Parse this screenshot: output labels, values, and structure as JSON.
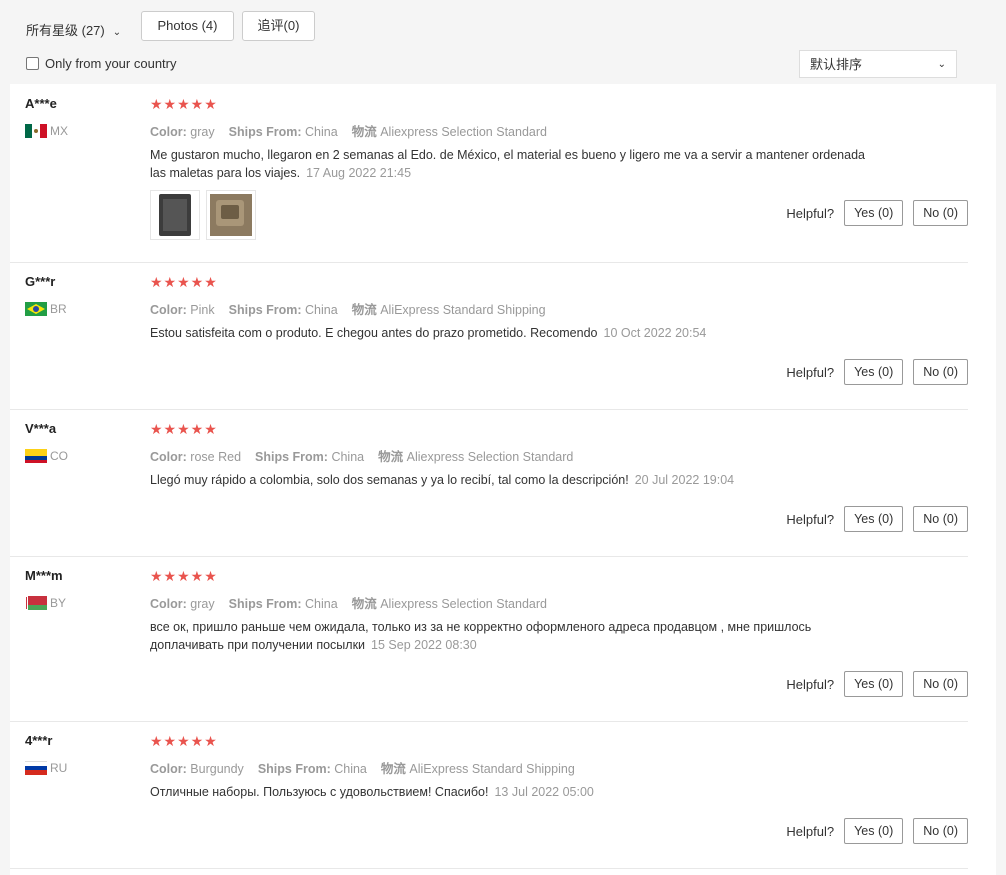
{
  "filters": {
    "star_label": "所有星级 (27)",
    "photos_label": "Photos (4)",
    "followup_label": "追评(0)",
    "country_label": "Only from your country",
    "sort_label": "默认排序"
  },
  "labels": {
    "color": "Color:",
    "ships_from": "Ships From:",
    "logistics": "物流",
    "helpful": "Helpful?",
    "yes": "Yes (0)",
    "no": "No (0)",
    "stars": "★★★★★"
  },
  "colors": {
    "star": "#e9544e",
    "muted": "#999999"
  },
  "reviews": [
    {
      "user": "A***e",
      "country": "MX",
      "flag_icon": "mexico-flag-icon",
      "color": "gray",
      "ships_from": "China",
      "shipping": "Aliexpress Selection Standard",
      "text": "Me gustaron mucho, llegaron en 2 semanas al Edo. de México, el material es bueno y ligero me va a servir a mantener ordenada las maletas para los viajes.",
      "date": "17 Aug 2022 21:45"
    },
    {
      "user": "G***r",
      "country": "BR",
      "flag_icon": "brazil-flag-icon",
      "color": "Pink",
      "ships_from": "China",
      "shipping": "AliExpress Standard Shipping",
      "text": "Estou satisfeita com o produto. E chegou antes do prazo prometido. Recomendo",
      "date": "10 Oct 2022 20:54"
    },
    {
      "user": "V***a",
      "country": "CO",
      "flag_icon": "colombia-flag-icon",
      "color": "rose Red",
      "ships_from": "China",
      "shipping": "Aliexpress Selection Standard",
      "text": "Llegó muy rápido a colombia, solo dos semanas y ya lo recibí, tal como la descripción!",
      "date": "20 Jul 2022 19:04"
    },
    {
      "user": "M***m",
      "country": "BY",
      "flag_icon": "belarus-flag-icon",
      "color": "gray",
      "ships_from": "China",
      "shipping": "Aliexpress Selection Standard",
      "text": "все ок, пришло раньше чем ожидала, только из за не корректно оформленого адреса продавцом , мне пришлось доплачивать при получении посылки",
      "date": "15 Sep 2022 08:30"
    },
    {
      "user": "4***r",
      "country": "RU",
      "flag_icon": "russia-flag-icon",
      "color": "Burgundy",
      "ships_from": "China",
      "shipping": "AliExpress Standard Shipping",
      "text": "Отличные наборы. Пользуюсь с удовольствием! Спасибо!",
      "date": "13 Jul 2022 05:00"
    }
  ]
}
